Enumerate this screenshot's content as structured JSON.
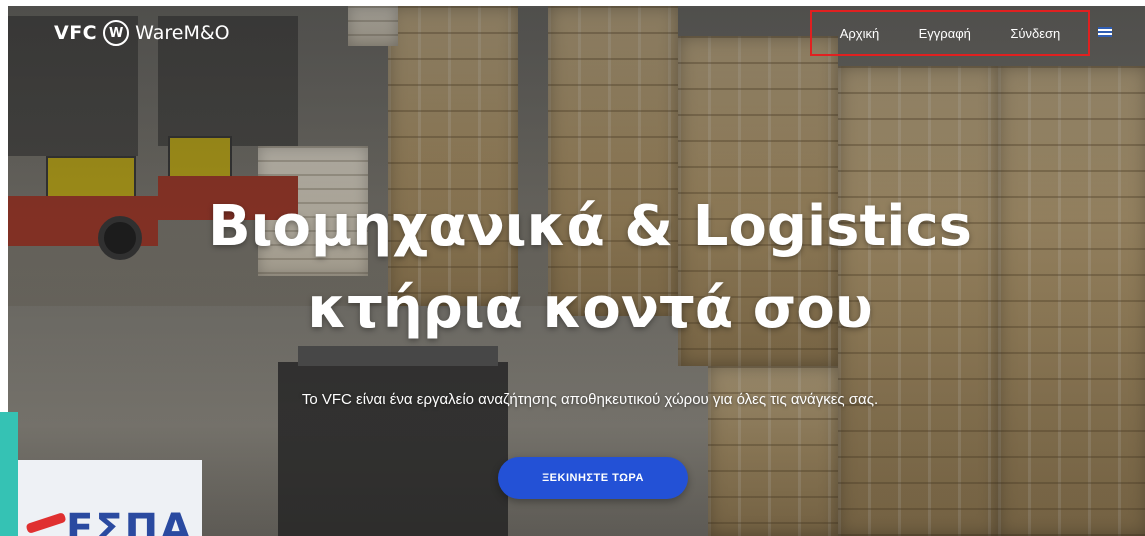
{
  "header": {
    "logo": {
      "brand": "VFC",
      "mark": "W",
      "product": "WareM&O"
    },
    "nav": [
      {
        "label": "Αρχική"
      },
      {
        "label": "Εγγραφή"
      },
      {
        "label": "Σύνδεση"
      }
    ],
    "language_icon": "greek-flag-icon"
  },
  "hero": {
    "headline_line1": "Βιομηχανικά & Logistics",
    "headline_line2": "κτήρια κοντά σου",
    "subtitle": "Το VFC είναι ένα εργαλείο αναζήτησης αποθηκευτικού χώρου για όλες τις ανάγκες σας.",
    "cta_label": "ΞΕΚΙΝΗΣΤΕ ΤΩΡΑ"
  },
  "badge": {
    "text": "ΕΣΠΑ"
  },
  "colors": {
    "accent": "#2351d6",
    "nav_highlight": "#e02020",
    "badge_accent": "#35c2b4",
    "badge_text": "#2a4aa0"
  }
}
